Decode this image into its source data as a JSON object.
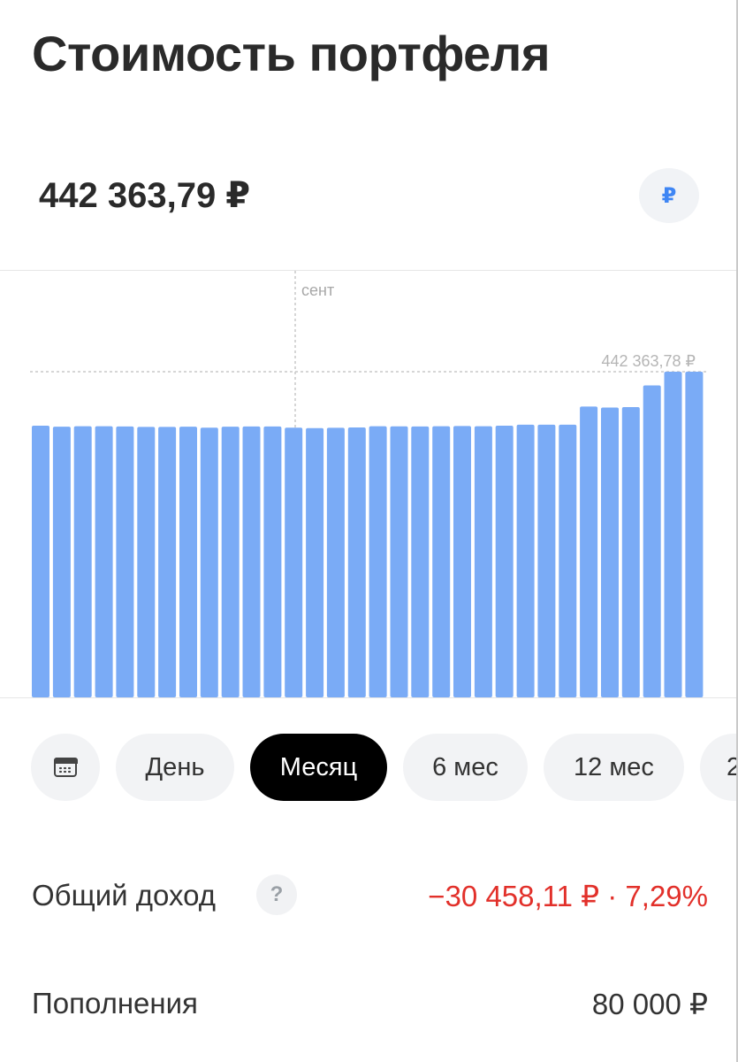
{
  "header": {
    "title": "Стоимость портфеля"
  },
  "portfolio": {
    "value": "442 363,79 ₽",
    "currency_symbol": "₽"
  },
  "chart_data": {
    "type": "bar",
    "month_marker": "сент",
    "max_label": "442 363,78 ₽",
    "max": 442363.78,
    "series": [
      {
        "values": [
          437000,
          436900,
          436950,
          436950,
          436920,
          436880,
          436880,
          436900,
          436800,
          436900,
          436920,
          436920,
          436800,
          436750,
          436790,
          436820,
          436950,
          436930,
          436920,
          436950,
          436960,
          436950,
          437000,
          437100,
          437100,
          437100,
          438900,
          438800,
          438850,
          441000,
          442363.78,
          442363.78
        ]
      }
    ],
    "colors": {
      "bar": "#7aabf6"
    }
  },
  "periods": [
    {
      "icon": "calendar-icon"
    },
    {
      "label": "День"
    },
    {
      "label": "Месяц",
      "active": true
    },
    {
      "label": "6 мес"
    },
    {
      "label": "12 мес"
    },
    {
      "label": "2"
    }
  ],
  "income": {
    "label": "Общий доход",
    "value": "−30 458,11 ₽ · 7,29%",
    "color": "#e2302a"
  },
  "deposits": {
    "label": "Пополнения",
    "value": "80 000 ₽"
  }
}
